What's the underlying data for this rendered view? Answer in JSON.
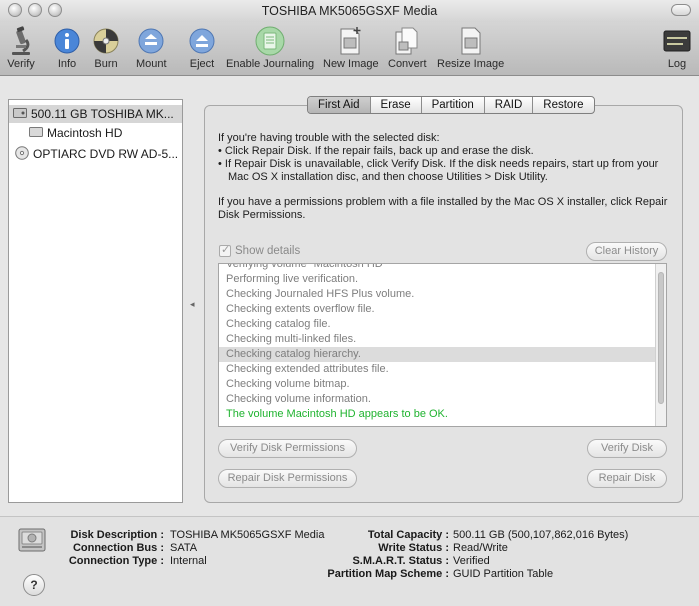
{
  "window": {
    "title": "TOSHIBA MK5065GSXF Media"
  },
  "toolbar": {
    "items": [
      {
        "label": "Verify",
        "icon": "microscope-icon"
      },
      {
        "label": "Info",
        "icon": "info-icon"
      },
      {
        "label": "Burn",
        "icon": "burn-icon"
      },
      {
        "label": "Mount",
        "icon": "mount-icon"
      },
      {
        "label": "Eject",
        "icon": "eject-icon"
      },
      {
        "label": "Enable Journaling",
        "icon": "journal-icon"
      },
      {
        "label": "New Image",
        "icon": "new-image-icon"
      },
      {
        "label": "Convert",
        "icon": "convert-icon"
      },
      {
        "label": "Resize Image",
        "icon": "resize-image-icon"
      },
      {
        "label": "Log",
        "icon": "log-icon"
      }
    ],
    "log_icon_text": "WARNIN\nAY 7 0:45"
  },
  "sidebar": {
    "items": [
      {
        "label": "500.11 GB TOSHIBA MK...",
        "selected": true
      },
      {
        "label": "Macintosh HD",
        "selected": false
      },
      {
        "label": "OPTIARC DVD RW AD-5...",
        "selected": false
      }
    ]
  },
  "tabs": [
    {
      "label": "First Aid",
      "active": true
    },
    {
      "label": "Erase",
      "active": false
    },
    {
      "label": "Partition",
      "active": false
    },
    {
      "label": "RAID",
      "active": false
    },
    {
      "label": "Restore",
      "active": false
    }
  ],
  "first_aid": {
    "intro": "If you're having trouble with the selected disk:",
    "bullet1": "• Click Repair Disk. If the repair fails, back up and erase the disk.",
    "bullet2": "• If Repair Disk is unavailable, click Verify Disk. If the disk needs repairs, start up from your Mac OS X installation disc, and then choose Utilities > Disk Utility.",
    "permissions": "If you have a permissions problem with a file installed by the Mac OS X installer, click Repair Disk Permissions.",
    "show_details": "Show details",
    "clear_history": "Clear History",
    "log_lines": [
      "Verifying volume \"Macintosh HD\"",
      "Performing live verification.",
      "Checking Journaled HFS Plus volume.",
      "Checking extents overflow file.",
      "Checking catalog file.",
      "Checking multi-linked files.",
      "Checking catalog hierarchy.",
      "Checking extended attributes file.",
      "Checking volume bitmap.",
      "Checking volume information.",
      "The volume Macintosh HD appears to be OK."
    ],
    "verify_permissions": "Verify Disk Permissions",
    "verify_disk": "Verify Disk",
    "repair_permissions": "Repair Disk Permissions",
    "repair_disk": "Repair Disk"
  },
  "info": {
    "disk_description_label": "Disk Description :",
    "disk_description": "TOSHIBA MK5065GSXF Media",
    "connection_bus_label": "Connection Bus :",
    "connection_bus": "SATA",
    "connection_type_label": "Connection Type :",
    "connection_type": "Internal",
    "total_capacity_label": "Total Capacity :",
    "total_capacity": "500.11 GB (500,107,862,016 Bytes)",
    "write_status_label": "Write Status :",
    "write_status": "Read/Write",
    "smart_status_label": "S.M.A.R.T. Status :",
    "smart_status": "Verified",
    "partition_scheme_label": "Partition Map Scheme :",
    "partition_scheme": "GUID Partition Table",
    "help": "?"
  },
  "colors": {
    "ok_text": "#1fb32f",
    "selected_row": "#d6d6d6"
  }
}
